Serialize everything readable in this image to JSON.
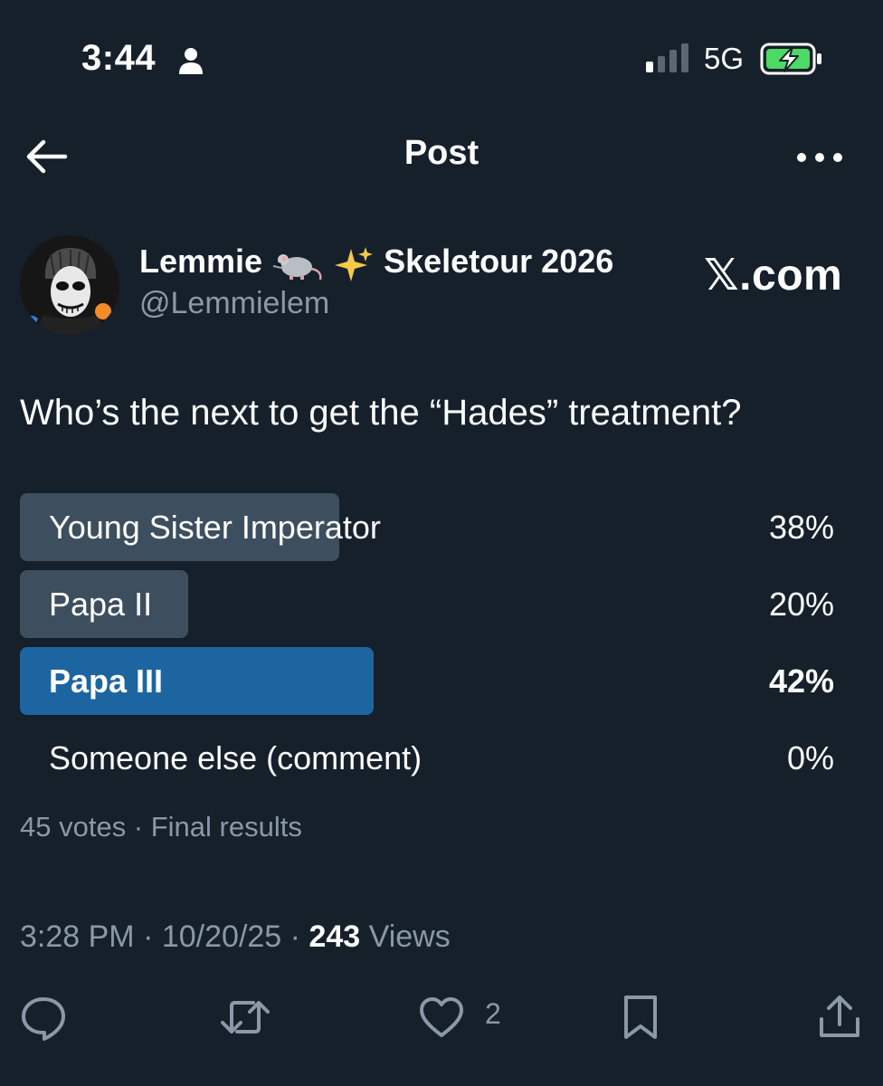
{
  "status_bar": {
    "time": "3:44",
    "network": "5G"
  },
  "header": {
    "title": "Post"
  },
  "author": {
    "display_name": "Lemmie",
    "display_name_suffix": "Skeletour 2026",
    "handle": "@Lemmielem",
    "watermark": "𝕏.com"
  },
  "post": {
    "text": "Who’s the next to get the “Hades” treatment?"
  },
  "poll": {
    "options": [
      {
        "label": "Young Sister Imperator",
        "percent_text": "38%",
        "share": 0.38,
        "winner": false
      },
      {
        "label": "Papa II",
        "percent_text": "20%",
        "share": 0.2,
        "winner": false
      },
      {
        "label": "Papa III",
        "percent_text": "42%",
        "share": 0.42,
        "winner": true
      },
      {
        "label": "Someone else (comment)",
        "percent_text": "0%",
        "share": 0.0,
        "winner": false
      }
    ],
    "summary": "45 votes · Final results"
  },
  "meta": {
    "time": "3:28 PM",
    "date": "10/20/25",
    "views_count": "243",
    "views_label": "Views"
  },
  "actions": {
    "like_count": "2",
    "icons": [
      "reply-icon",
      "repost-icon",
      "like-icon",
      "bookmark-icon",
      "share-icon"
    ]
  },
  "colors": {
    "background": "#15202b",
    "bar_neutral": "#3d4e5e",
    "bar_winner": "#1d65a0",
    "muted_text": "#8b98a5",
    "battery_green": "#4cd964"
  }
}
